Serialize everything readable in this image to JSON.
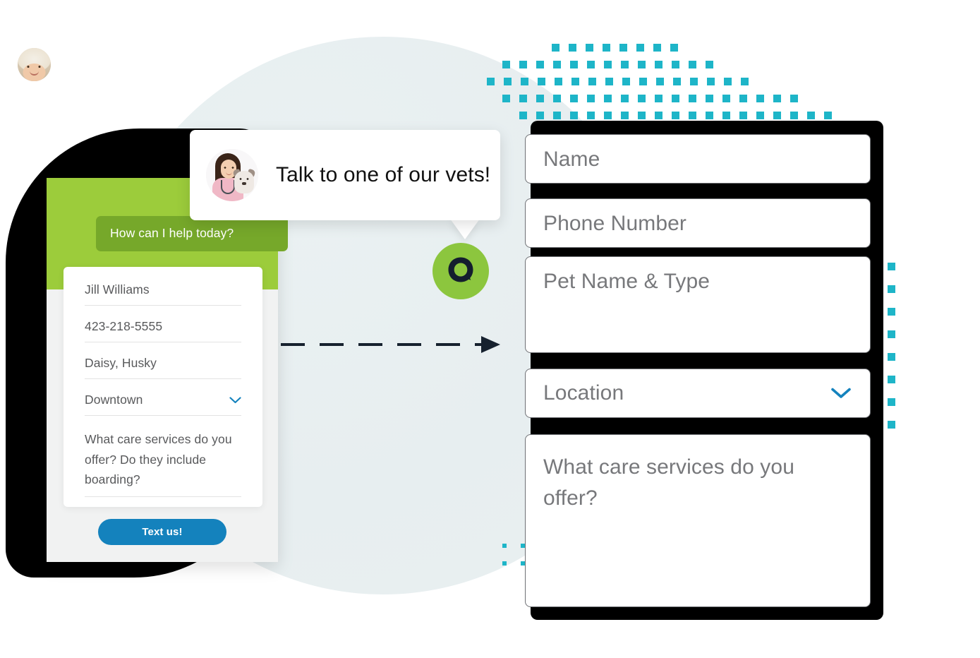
{
  "colors": {
    "brand_green_header": "#9ccc3b",
    "brand_green_bubble": "#76a82a",
    "launcher_green": "#8cc63e",
    "button_blue": "#1482bd",
    "dot_teal": "#1eb5c8",
    "circle_bg": "#e8eff0",
    "shadow_black": "#000000",
    "placeholder_gray": "#77787b"
  },
  "callout": {
    "text": "Talk to one of our vets!",
    "avatar_icon": "vet-with-dog-avatar-icon"
  },
  "launcher": {
    "icon": "chat-bubble-q-icon",
    "label": "Q"
  },
  "flow": {
    "arrow_icon": "dashed-right-arrow-icon"
  },
  "chat_widget": {
    "agent_avatar_icon": "agent-avatar-icon",
    "greeting": "How can I help today?",
    "fields": [
      {
        "name": "name",
        "value": "Jill Williams"
      },
      {
        "name": "phone",
        "value": "423-218-5555"
      },
      {
        "name": "pet",
        "value": "Daisy, Husky"
      },
      {
        "name": "location",
        "value": "Downtown",
        "caret_icon": "chevron-down-icon"
      },
      {
        "name": "message",
        "value": "What care services do you offer? Do they include boarding?"
      }
    ],
    "submit_label": "Text us!"
  },
  "form_panel": {
    "fields": [
      {
        "name": "name",
        "placeholder": "Name"
      },
      {
        "name": "phone",
        "placeholder": "Phone Number"
      },
      {
        "name": "pet",
        "placeholder": "Pet Name & Type"
      },
      {
        "name": "location",
        "placeholder": "Location",
        "caret_icon": "chevron-down-icon"
      },
      {
        "name": "message",
        "placeholder": "What care services do you offer?"
      }
    ]
  }
}
